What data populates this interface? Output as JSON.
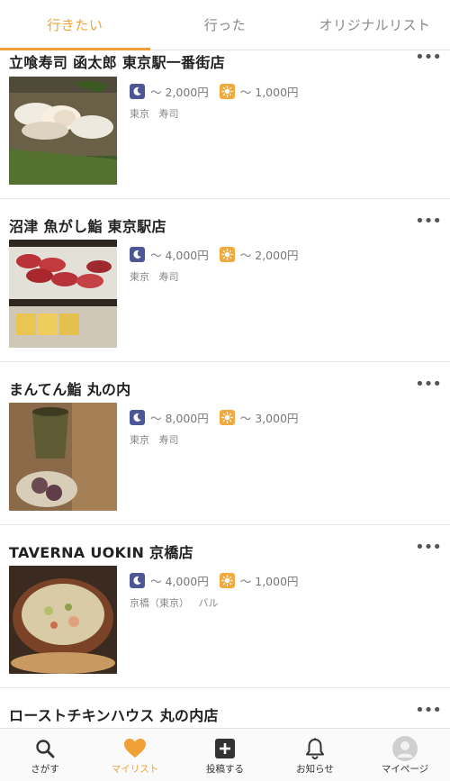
{
  "tabs": [
    {
      "label": "行きたい"
    },
    {
      "label": "行った"
    },
    {
      "label": "オリジナルリスト"
    }
  ],
  "more_label": "•••",
  "restaurants": [
    {
      "name": "立喰寿司 函太郎 東京駅一番街店",
      "night_price": "～ 2,000円",
      "day_price": "～ 1,000円",
      "area": "東京",
      "genre": "寿司"
    },
    {
      "name": "沼津 魚がし鮨 東京駅店",
      "night_price": "～ 4,000円",
      "day_price": "～ 2,000円",
      "area": "東京",
      "genre": "寿司"
    },
    {
      "name": "まんてん鮨 丸の内",
      "night_price": "～ 8,000円",
      "day_price": "～ 3,000円",
      "area": "東京",
      "genre": "寿司"
    },
    {
      "name": "TAVERNA UOKIN 京橋店",
      "night_price": "～ 4,000円",
      "day_price": "～ 1,000円",
      "area": "京橋（東京）",
      "genre": "バル"
    },
    {
      "name": "ローストチキンハウス 丸の内店"
    }
  ],
  "bottom_nav": [
    {
      "label": "さがす",
      "icon": "search-icon"
    },
    {
      "label": "マイリスト",
      "icon": "heart-icon"
    },
    {
      "label": "投稿する",
      "icon": "plus-square-icon"
    },
    {
      "label": "お知らせ",
      "icon": "bell-icon"
    },
    {
      "label": "マイページ",
      "icon": "avatar-icon"
    }
  ],
  "colors": {
    "accent": "#f0a036",
    "night": "#4d5796",
    "day": "#f3aa3c"
  }
}
